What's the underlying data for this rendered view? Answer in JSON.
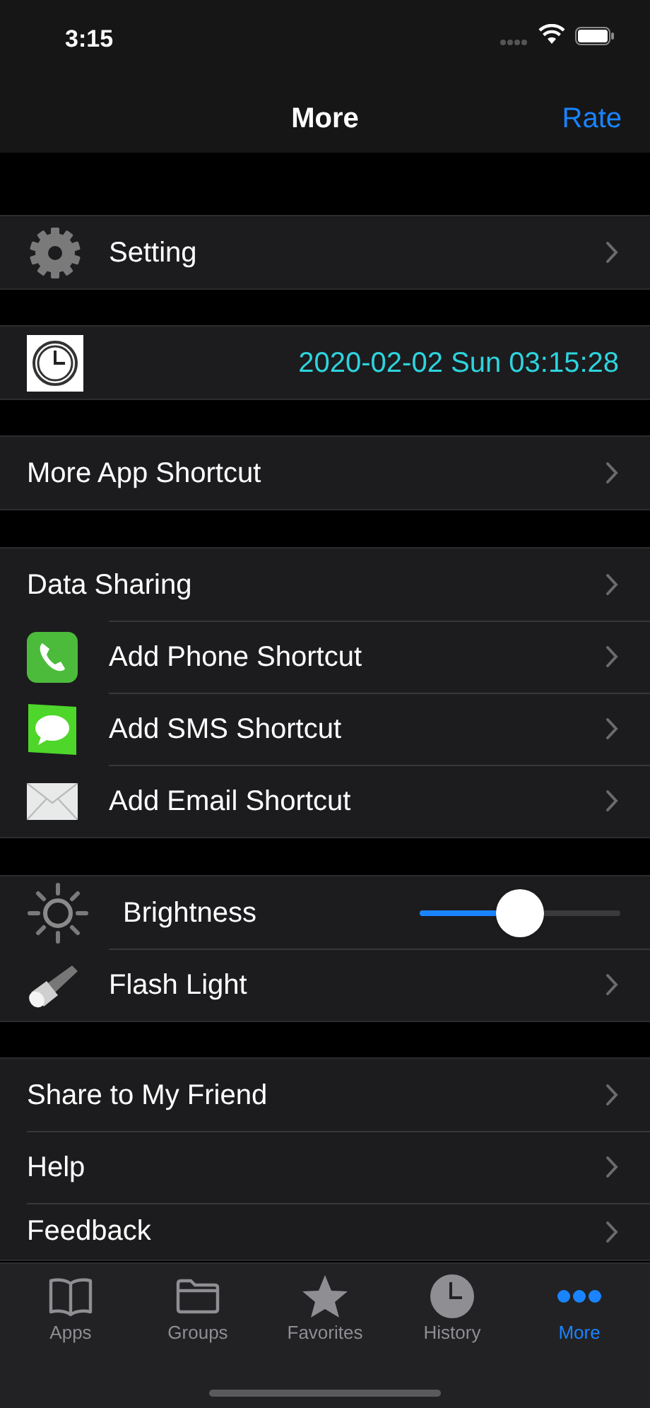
{
  "status_bar": {
    "time": "3:15"
  },
  "nav_bar": {
    "title": "More",
    "action": "Rate"
  },
  "sections": [
    {
      "rows": [
        {
          "kind": "link",
          "label": "Setting",
          "disclosure": true
        }
      ]
    },
    {
      "rows": [
        {
          "kind": "clock",
          "value": "2020-02-02 Sun 03:15:28",
          "disclosure": false
        }
      ]
    },
    {
      "rows": [
        {
          "kind": "link",
          "label": "More App Shortcut",
          "disclosure": true
        }
      ]
    },
    {
      "rows": [
        {
          "kind": "link",
          "label": "Data Sharing",
          "disclosure": true
        },
        {
          "kind": "link",
          "label": "Add Phone Shortcut",
          "disclosure": true
        },
        {
          "kind": "link",
          "label": "Add SMS Shortcut",
          "disclosure": true
        },
        {
          "kind": "link",
          "label": "Add Email Shortcut",
          "disclosure": true
        }
      ]
    },
    {
      "rows": [
        {
          "kind": "slider",
          "label": "Brightness",
          "level": 0.5,
          "disclosure": false
        },
        {
          "kind": "link",
          "label": "Flash Light",
          "disclosure": true
        }
      ]
    },
    {
      "rows": [
        {
          "kind": "link",
          "label": "Share to My Friend",
          "disclosure": true
        },
        {
          "kind": "link",
          "label": "Help",
          "disclosure": true
        },
        {
          "kind": "link",
          "label": "Feedback",
          "disclosure": true
        }
      ]
    }
  ],
  "tab_bar": [
    {
      "label": "Apps",
      "selected": false
    },
    {
      "label": "Groups",
      "selected": false
    },
    {
      "label": "Favorites",
      "selected": false
    },
    {
      "label": "History",
      "selected": false
    },
    {
      "label": "More",
      "selected": true
    }
  ]
}
